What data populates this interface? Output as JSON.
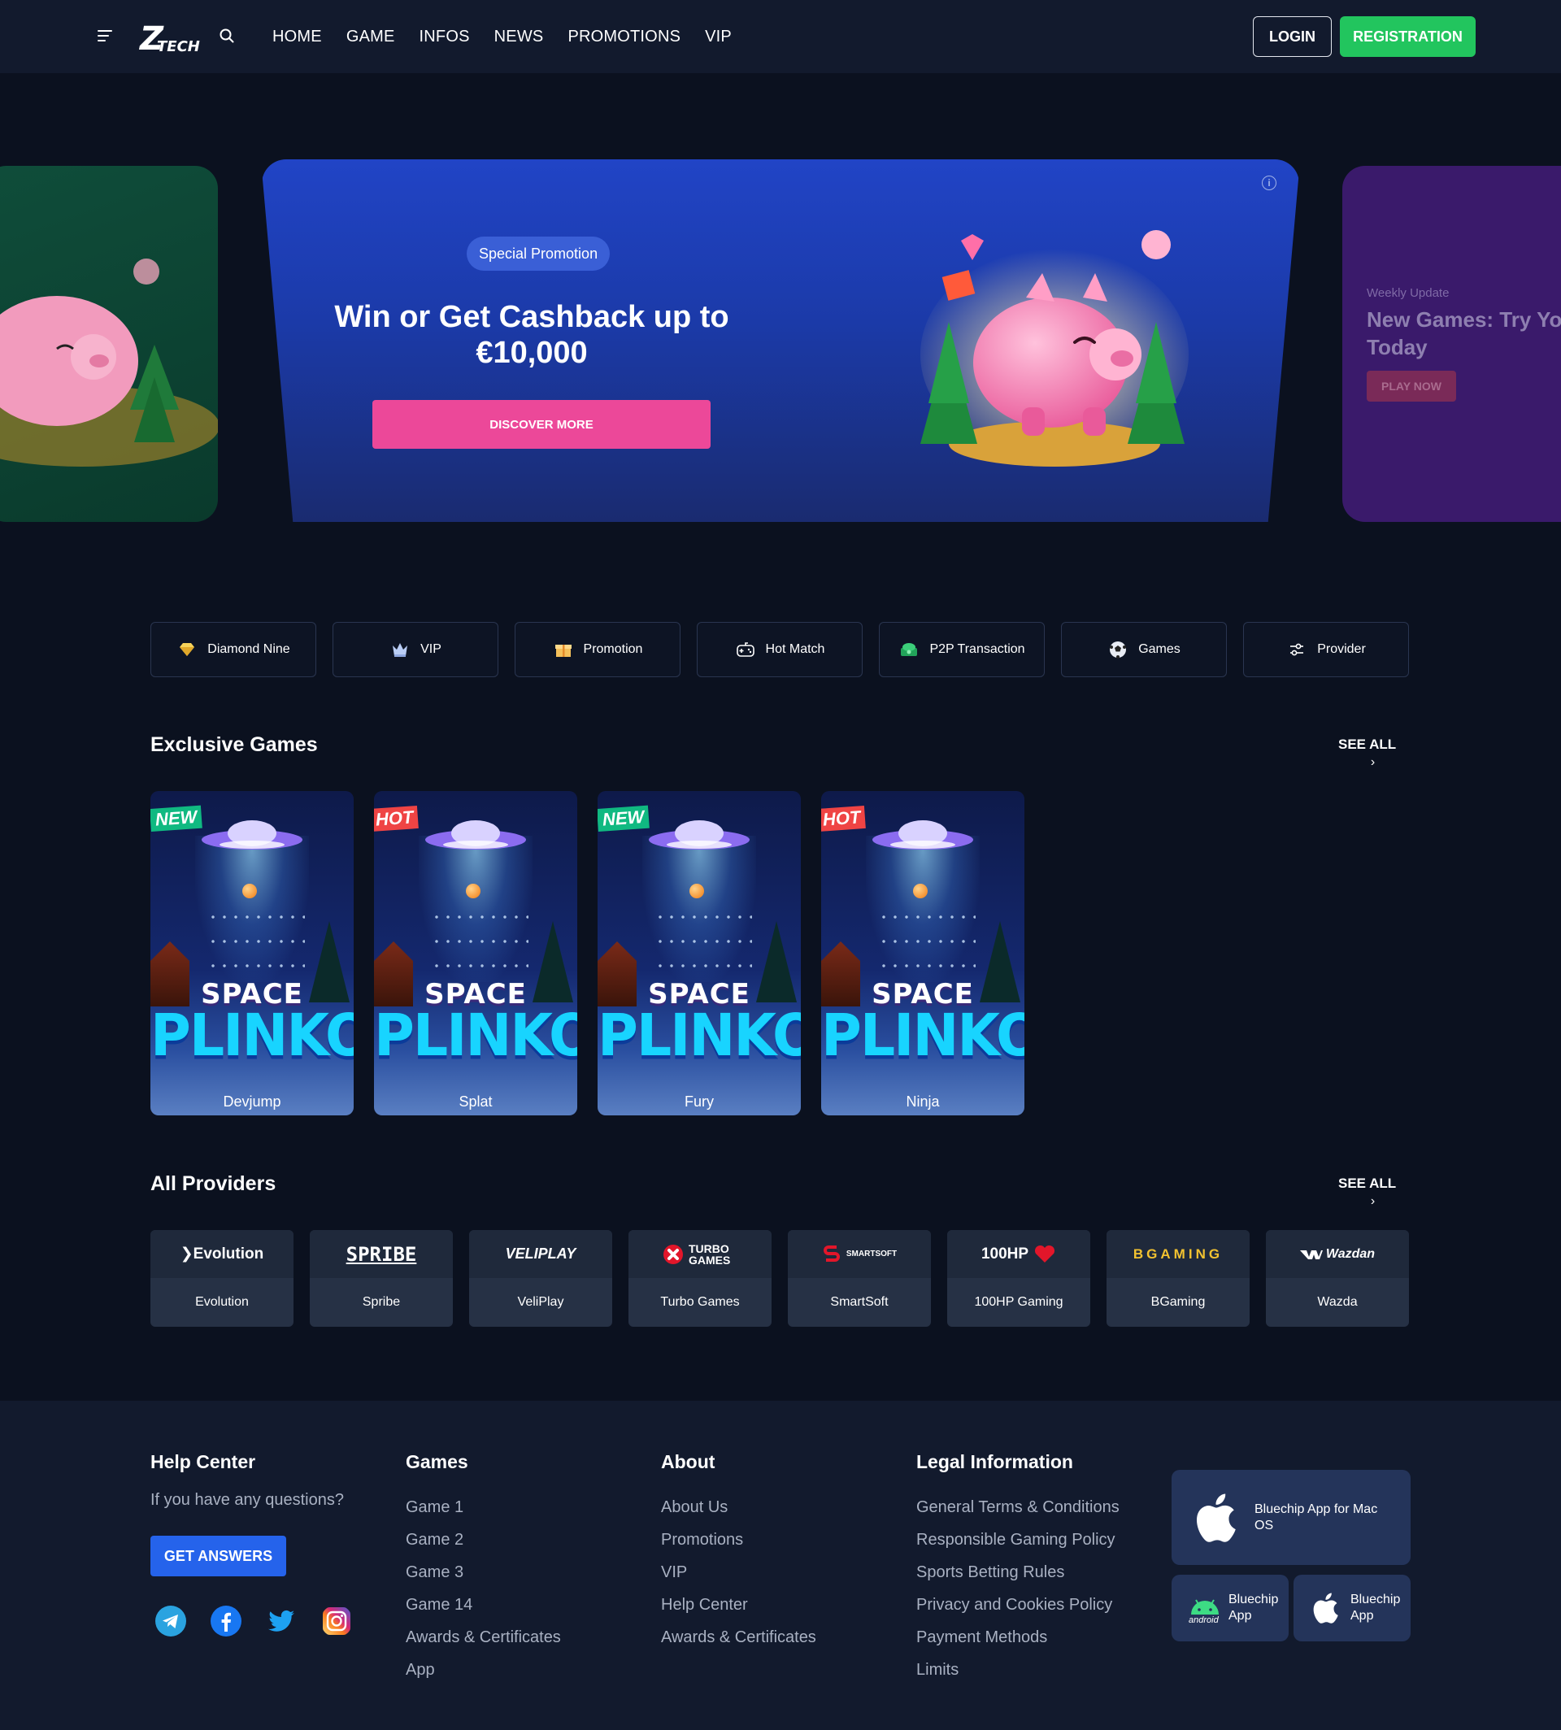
{
  "header": {
    "logo_text": "Z",
    "logo_sub": "TECH",
    "nav": [
      "HOME",
      "GAME",
      "INFOS",
      "NEWS",
      "PROMOTIONS",
      "VIP"
    ],
    "login": "LOGIN",
    "register": "REGISTRATION"
  },
  "carousel": {
    "main": {
      "badge": "Special Promotion",
      "title": "Win or Get Cashback up to €10,000",
      "button": "DISCOVER MORE",
      "info": "i"
    },
    "right": {
      "eyebrow": "Weekly Update",
      "title": "New Games: Try Yo Today",
      "title_line1": "New Games: Try Yo",
      "title_line2": "Today",
      "button": "PLAY NOW"
    }
  },
  "categories": [
    {
      "label": "Diamond Nine",
      "icon": "diamond-icon"
    },
    {
      "label": "VIP",
      "icon": "crown-icon"
    },
    {
      "label": "Promotion",
      "icon": "gift-icon"
    },
    {
      "label": "Hot Match",
      "icon": "gamepad-icon"
    },
    {
      "label": "P2P Transaction",
      "icon": "money-icon"
    },
    {
      "label": "Games",
      "icon": "soccer-ball-icon"
    },
    {
      "label": "Provider",
      "icon": "sliders-icon"
    }
  ],
  "exclusive": {
    "title": "Exclusive Games",
    "see_all": "SEE ALL",
    "chevron": "›",
    "games": [
      {
        "name": "Devjump",
        "tag": "NEW",
        "art_line1": "SPACE",
        "art_line2": "PLINKO"
      },
      {
        "name": "Splat",
        "tag": "HOT",
        "art_line1": "SPACE",
        "art_line2": "PLINKO"
      },
      {
        "name": "Fury",
        "tag": "NEW",
        "art_line1": "SPACE",
        "art_line2": "PLINKO"
      },
      {
        "name": "Ninja",
        "tag": "HOT",
        "art_line1": "SPACE",
        "art_line2": "PLINKO"
      }
    ]
  },
  "providers": {
    "title": "All Providers",
    "see_all": "SEE ALL",
    "chevron": "›",
    "items": [
      {
        "logo": "Evolution",
        "name": "Evolution"
      },
      {
        "logo": "SPRIBE",
        "name": "Spribe"
      },
      {
        "logo": "VELIPLAY",
        "name": "VeliPlay"
      },
      {
        "logo": "TURBO GAMES",
        "name": "Turbo Games"
      },
      {
        "logo": "SMARTSOFT",
        "name": "SmartSoft"
      },
      {
        "logo": "100HP",
        "name": "100HP Gaming"
      },
      {
        "logo": "BGAMING",
        "name": "BGaming"
      },
      {
        "logo": "Wazdan",
        "name": "Wazda"
      }
    ]
  },
  "footer": {
    "help": {
      "title": "Help Center",
      "question": "If you have any questions?",
      "button": "GET ANSWERS"
    },
    "games": {
      "title": "Games",
      "links": [
        "Game 1",
        "Game 2",
        "Game 3",
        "Game 14",
        "Awards & Certificates",
        "App"
      ]
    },
    "about": {
      "title": "About",
      "links": [
        "About Us",
        "Promotions",
        "VIP",
        "Help Center",
        "Awards & Certificates"
      ]
    },
    "legal": {
      "title": "Legal Information",
      "links": [
        "General Terms & Conditions",
        "Responsible Gaming Policy",
        "Sports Betting Rules",
        "Privacy and Cookies Policy",
        "Payment Methods",
        "Limits"
      ]
    },
    "apps": {
      "mac": "Bluechip App for Mac OS",
      "android_l1": "Bluechip",
      "android_l2": "App",
      "android_badge": "android",
      "ios_l1": "Bluechip",
      "ios_l2": "App"
    }
  },
  "colors": {
    "accent_green": "#22c55e",
    "accent_pink": "#ec4899",
    "accent_blue": "#2563eb",
    "bg": "#0b111f"
  }
}
